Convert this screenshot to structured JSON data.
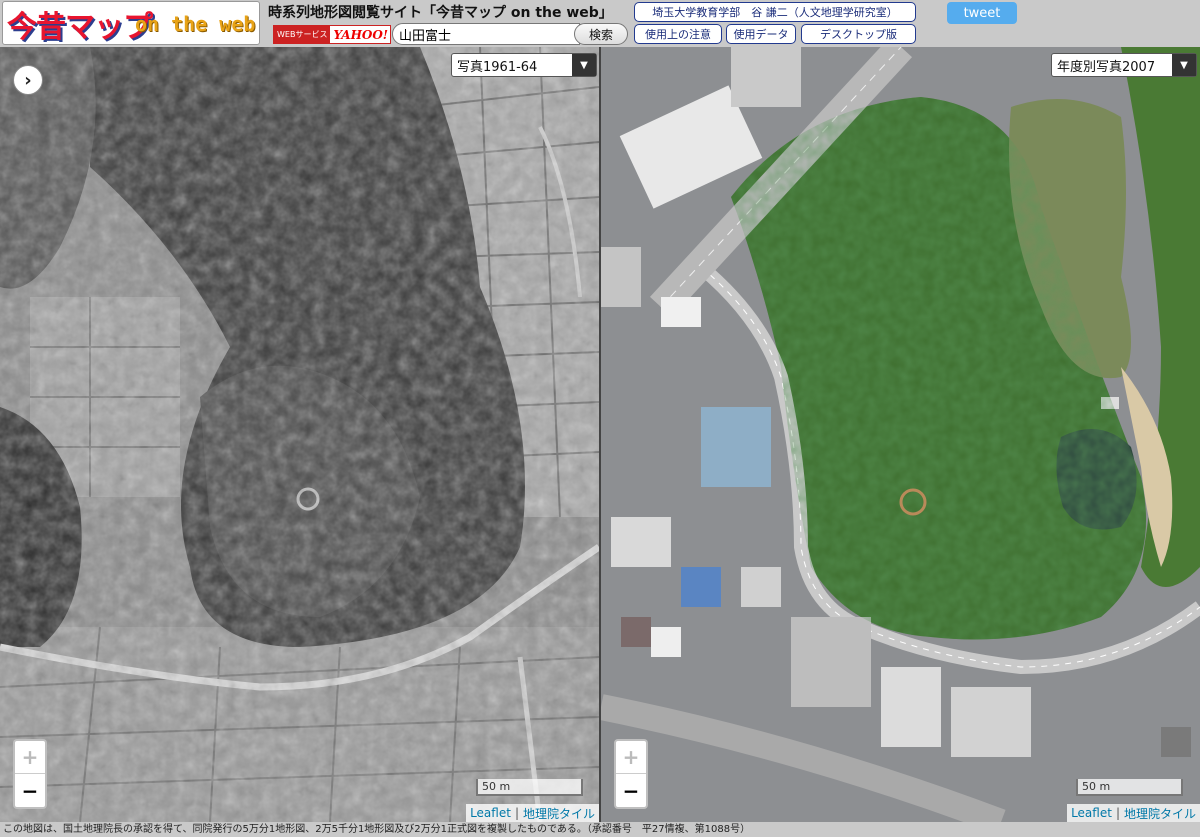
{
  "header": {
    "logo_jp": "今昔マップ",
    "logo_en": "on the web",
    "site_title": "時系列地形図閲覧サイト「今昔マップ on the web」",
    "yahoo_badge_service": "WEBサービス",
    "yahoo_badge_brand": "YAHOO!",
    "search_value": "山田富士",
    "search_button": "検索",
    "affiliation": "埼玉大学教育学部　谷 謙二（人文地理学研究室）",
    "notes_button": "使用上の注意",
    "data_button": "使用データ",
    "desktop_button": "デスクトップ版",
    "tweet_button": "tweet"
  },
  "left_map": {
    "layer": "写真1961-64",
    "toggle_icon": "›",
    "zoom_in": "+",
    "zoom_out": "−",
    "scale": "50 m",
    "attribution_leaflet": "Leaflet",
    "attribution_tiles": "地理院タイル"
  },
  "right_map": {
    "layer": "年度別写真2007",
    "zoom_in": "+",
    "zoom_out": "−",
    "scale": "50 m",
    "attribution_leaflet": "Leaflet",
    "attribution_tiles": "地理院タイル"
  },
  "footer": {
    "notice": "この地図は、国土地理院長の承認を得て、同院発行の5万分1地形図、2万5千分1地形図及び2万分1正式図を複製したものである。（承認番号　平27情複、第1088号）"
  },
  "colors": {
    "tweet": "#55acee",
    "logo_red": "#e8152f",
    "logo_orange": "#e8a317",
    "button_border": "#223a8f"
  }
}
